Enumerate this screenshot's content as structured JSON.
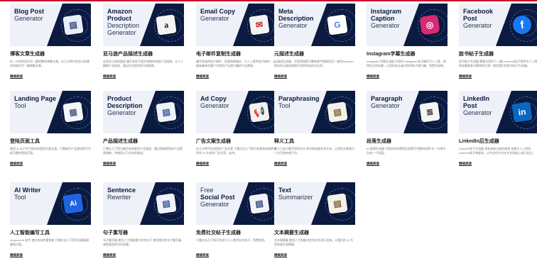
{
  "cards": [
    {
      "b_title": "Blog Post",
      "b_sub": "Generator",
      "icon": "blog-doc-icon",
      "glyph": "▤",
      "accent": "#e8eef8",
      "fg": "#3a4a7a",
      "zh_title": "博客文章生成器",
      "desc": "在一卡的时间内写一篇完整的博客文章。在几分钟内完全以你喜欢的格式写一篇博客文章。",
      "link": "继续阅读"
    },
    {
      "b_title": "Amazon",
      "b_title2": "Product",
      "b_sub": "Description",
      "b_sub2": "Generator",
      "icon": "amazon-icon",
      "glyph": "a",
      "accent": "#f4f4f4",
      "fg": "#111111",
      "zh_title": "亚马逊产品描述生成器",
      "desc": "适合亚马逊的描述 编写有利于提升销售的有效产品描述。让人人都能产品描述，通过优化您的亚马逊搜索。",
      "link": "继续阅读"
    },
    {
      "b_title": "Email Copy",
      "b_sub": "Generator",
      "icon": "email-icon",
      "glyph": "✉",
      "accent": "#f3f3f3",
      "fg": "#c62828",
      "zh_title": "电子邮件复制生成器",
      "desc": "编写有效的电子邮件，回复和邮箱文，引人入胜的电子邮件，让越来越多的客户对您的产品感兴趣的产品营销。",
      "link": "继续阅读"
    },
    {
      "b_title": "Meta",
      "b_title2": "Description",
      "b_sub": "Generator",
      "icon": "google-icon",
      "glyph": "G",
      "accent": "#ffffff",
      "fg": "#4285f4",
      "zh_title": "元描述生成器",
      "desc": "元描述生成器，在您的搜索引擎结果中脱颖而出？使用Keyword相关的元描述来提升您的网站的点击率。",
      "link": "继续阅读"
    },
    {
      "b_title": "Instagram",
      "b_title2": "Caption",
      "b_sub": "Generator",
      "icon": "instagram-icon",
      "glyph": "◎",
      "accent": "#d62976",
      "fg": "#ffffff",
      "zh_title": "Instagram字幕生成器",
      "desc": "Instagram 字幕生成器 为您的 Instagram 帖子编写引人入胜、值得关注的标题，让您的关注者对您的帖子感兴趣。免费开始吧。",
      "link": "继续阅读"
    },
    {
      "b_title": "Facebook",
      "b_title2": "Post",
      "b_sub": "Generator",
      "icon": "facebook-icon",
      "glyph": "f",
      "accent": "#1877f2",
      "fg": "#ffffff",
      "zh_title": "脸书帖子生成器",
      "desc": "脸书帖子生成器 需要为您的下一篇Facebook帖子提供引人入胜的标题和吸引眼球的文案？使用我们的脸书帖子生成器。",
      "link": "继续阅读"
    },
    {
      "b_title": "Landing Page",
      "b_sub": "Tool",
      "icon": "landing-page-icon",
      "glyph": "▦",
      "accent": "#f4f6fb",
      "fg": "#5a6a8a",
      "zh_title": "登陆页面工具",
      "desc": "使用 AI 从产生可转化的登陆页面文案。只需填写产品描述即可生成可靠的登陆页面。",
      "link": "继续阅读"
    },
    {
      "b_title": "Product",
      "b_title2": "Description",
      "b_sub": "Generator",
      "icon": "product-doc-icon",
      "glyph": "▤",
      "accent": "#eef3fb",
      "fg": "#3a5a9a",
      "zh_title": "产品描述生成器",
      "desc": "只需在几下您可编写有创意的产品描述，通过智能帮您的产品提高销售，并使用以下优化的描述。",
      "link": "继续阅读"
    },
    {
      "b_title": "Ad Copy",
      "b_sub": "Generator",
      "icon": "megaphone-icon",
      "glyph": "📢",
      "accent": "#f1f1f1",
      "fg": "#333333",
      "zh_title": "广告文案生成器",
      "desc": "在几分钟内生成您的广告文案 只需点击几下即可创建具有高转化率的 AI 生成的广告文案，支持。",
      "link": "继续阅读"
    },
    {
      "b_title": "Paraphrasing",
      "b_sub": "Tool",
      "icon": "paraphrase-icon",
      "glyph": "▤",
      "accent": "#f3f1ea",
      "fg": "#7a6a3a",
      "zh_title": "释义工具",
      "desc": "释义工具可重写您的文本 改写和改变任何文本。让您的文章更引人注目和有吸引力。",
      "link": "继续阅读"
    },
    {
      "b_title": "Paragraph",
      "b_sub": "Generator",
      "icon": "paragraph-icon",
      "glyph": "≣",
      "accent": "#f5f5f5",
      "fg": "#333333",
      "zh_title": "段落生成器",
      "desc": "AI 段落生成器 为您的所有营销文案撰写完整的段落 在一分钟内生成一个段落。",
      "link": "继续阅读"
    },
    {
      "b_title": "LinkedIn",
      "b_title2": "Post",
      "b_sub": "Generator",
      "icon": "linkedin-icon",
      "glyph": "in",
      "accent": "#0a66c2",
      "fg": "#ffffff",
      "zh_title": "LinkedIn后生成器",
      "desc": "LinkedIn帖子生成器 具有高参与度的网络 创建引人入胜的 LinkedIn帖子和更多。以专业的方式在专业网络上吸引关注。",
      "link": "继续阅读"
    },
    {
      "b_title": "AI Writer",
      "b_sub": "Tool",
      "icon": "ai-chip-icon",
      "glyph": "Ai",
      "accent": "#1f63e0",
      "fg": "#ffffff",
      "zh_title": "人工智能编写工具",
      "desc": "Anyword AI 助手 使文本创作更智能 只需点击几下即可创建高质量的内容。",
      "link": "继续阅读"
    },
    {
      "b_title": "Sentence",
      "b_sub": "Rewriter",
      "icon": "sentence-icon",
      "glyph": "▤",
      "accent": "#eef3fb",
      "fg": "#3a5a9a",
      "zh_title": "句子重写器",
      "desc": "句子重写器 使用人工智能重写任何句子 使用我们的句子重写器来提高您的写作质量。",
      "link": "继续阅读"
    },
    {
      "b_title": "Free",
      "b_title2": "Social Post",
      "b_sub": "Generator",
      "icon": "social-post-icon",
      "glyph": "▤",
      "accent": "#f0f3fa",
      "fg": "#3a4a7a",
      "zh_title": "免费社交帖子生成器",
      "desc": "只需点击几下即可生成引人入胜的社交帖子，免费使用。",
      "link": "继续阅读"
    },
    {
      "b_title": "Text",
      "b_sub": "Summarizer",
      "icon": "summarizer-icon",
      "glyph": "▤",
      "accent": "#f3f1ea",
      "fg": "#7a6a3a",
      "zh_title": "文本摘要生成器",
      "desc": "文本摘要器 使用人工智能对任何文本进行总结。让我们的 AI 为您快速生成摘要。",
      "link": "继续阅读"
    }
  ]
}
